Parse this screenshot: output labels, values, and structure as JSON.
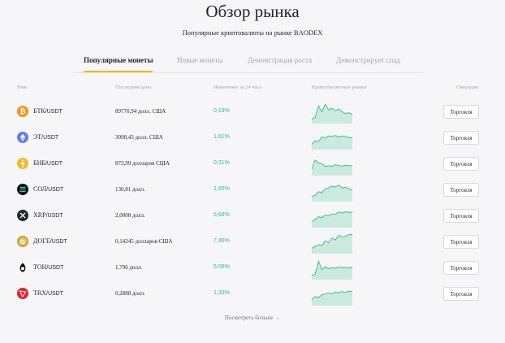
{
  "page": {
    "title": "Обзор рынка",
    "subtitle": "Популярные криптовалюты на рынке BAODEX"
  },
  "tabs": [
    {
      "label": "Популярные монеты"
    },
    {
      "label": "Новые монеты"
    },
    {
      "label": "Демонстрация роста"
    },
    {
      "label": "Демонстрирует спад"
    }
  ],
  "table": {
    "headers": {
      "name": "Имя",
      "price": "Последняя цена",
      "change": "Изменение за 24 часа",
      "chart": "Криптовалютные рынки",
      "action": "Операция"
    },
    "rows": [
      {
        "base": "БТК",
        "quote": "/USDT",
        "price": "89770,94 долл. США",
        "change": "0,19%",
        "icon": "bitcoin-icon",
        "color": "#f7931a",
        "trade": "Торговля",
        "spark": [
          0.1,
          0.2,
          0.8,
          0.5,
          0.9,
          0.6,
          0.7,
          0.55,
          0.65,
          0.5,
          0.4,
          0.45,
          0.35
        ]
      },
      {
        "base": "ЭТ",
        "quote": "/USDT",
        "price": "3098,43 долл. США",
        "change": "1,61%",
        "icon": "ethereum-icon",
        "color": "#627eea",
        "trade": "Торговля",
        "spark": [
          0.15,
          0.35,
          0.3,
          0.55,
          0.5,
          0.6,
          0.58,
          0.62,
          0.55,
          0.6,
          0.57,
          0.5,
          0.52
        ]
      },
      {
        "base": "БНБ",
        "quote": "/USDT",
        "price": "873,99 долларов США",
        "change": "0,31%",
        "icon": "bnb-icon",
        "color": "#f3ba2f",
        "trade": "Торговля",
        "spark": [
          0.2,
          0.7,
          0.55,
          0.5,
          0.35,
          0.4,
          0.35,
          0.45,
          0.4,
          0.38,
          0.42,
          0.4,
          0.4
        ]
      },
      {
        "base": "СОЛ",
        "quote": "/USDT",
        "price": "130,81 долл.",
        "change": "1,65%",
        "icon": "solana-icon",
        "color": "#111111",
        "trade": "Торговля",
        "spark": [
          0.15,
          0.2,
          0.4,
          0.35,
          0.55,
          0.6,
          0.7,
          0.65,
          0.75,
          0.6,
          0.65,
          0.55,
          0.5
        ]
      },
      {
        "base": "XRP",
        "quote": "/USDT",
        "price": "2,0008 долл.",
        "change": "5,68%",
        "icon": "xrp-icon",
        "color": "#23292f",
        "trade": "Торговля",
        "spark": [
          0.2,
          0.3,
          0.45,
          0.4,
          0.55,
          0.5,
          0.6,
          0.58,
          0.7,
          0.65,
          0.72,
          0.68,
          0.7
        ]
      },
      {
        "base": "ДОГЕ",
        "quote": "/USDT",
        "price": "0,14245 долларов США",
        "change": "7,46%",
        "icon": "dogecoin-icon",
        "color": "#c2a633",
        "trade": "Торговля",
        "spark": [
          0.15,
          0.25,
          0.35,
          0.3,
          0.55,
          0.45,
          0.7,
          0.6,
          0.85,
          0.75,
          0.8,
          0.9,
          0.88
        ]
      },
      {
        "base": "ТОН",
        "quote": "/USDT",
        "price": "1,796 долл.",
        "change": "5,06%",
        "icon": "ton-icon",
        "color": "#0a0a0a",
        "trade": "Торговля",
        "spark": [
          0.1,
          0.15,
          0.85,
          0.4,
          0.55,
          0.45,
          0.5,
          0.48,
          0.55,
          0.5,
          0.52,
          0.48,
          0.55
        ]
      },
      {
        "base": "TRX",
        "quote": "/USDT",
        "price": "0,2888 долл.",
        "change": "1,33%",
        "icon": "tron-icon",
        "color": "#e3212e",
        "trade": "Торговля",
        "spark": [
          0.2,
          0.35,
          0.3,
          0.45,
          0.5,
          0.55,
          0.5,
          0.6,
          0.55,
          0.62,
          0.58,
          0.65,
          0.62
        ]
      }
    ]
  },
  "footer": {
    "more_label": "Посмотреть больше →"
  },
  "colors": {
    "accent": "#f0b90b",
    "positive": "#2ebd85"
  }
}
